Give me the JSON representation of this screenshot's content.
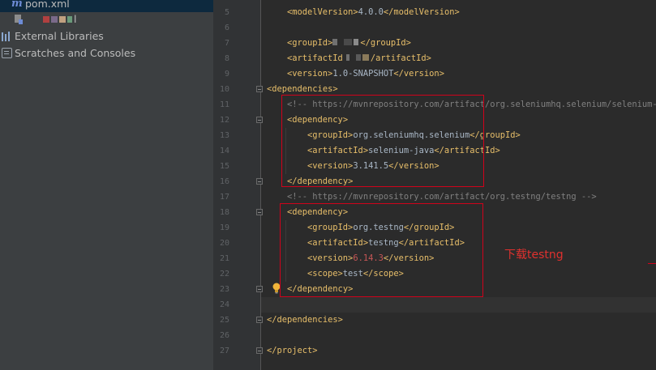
{
  "project_tree": {
    "items": [
      {
        "label": "pom.xml",
        "icon": "maven-file-icon"
      },
      {
        "label": "l",
        "icon": "module-file-icon"
      },
      {
        "label": "External Libraries",
        "icon": "library-icon"
      },
      {
        "label": "Scratches and Consoles",
        "icon": "scratches-icon"
      }
    ]
  },
  "editor": {
    "line_numbers": [
      "5",
      "6",
      "7",
      "8",
      "9",
      "10",
      "11",
      "12",
      "13",
      "14",
      "15",
      "16",
      "17",
      "18",
      "19",
      "20",
      "21",
      "22",
      "23",
      "24",
      "25",
      "26",
      "27"
    ],
    "lines": {
      "l5": {
        "open": "<modelVersion>",
        "text": "4.0.0",
        "close": "</modelVersion>"
      },
      "l7": {
        "open": "<groupId>",
        "close": "</groupId>"
      },
      "l8": {
        "open": "<artifactId",
        "close": "/artifactId>"
      },
      "l9": {
        "open": "<version>",
        "text": "1.0-SNAPSHOT",
        "close": "</version>"
      },
      "l10": {
        "open": "<dependencies>"
      },
      "l11": {
        "comment": "<!-- https://mvnrepository.com/artifact/org.seleniumhq.selenium/selenium-jav"
      },
      "l12": {
        "open": "<dependency>"
      },
      "l13": {
        "open": "<groupId>",
        "text": "org.seleniumhq.selenium",
        "close": "</groupId>"
      },
      "l14": {
        "open": "<artifactId>",
        "text": "selenium-java",
        "close": "</artifactId>"
      },
      "l15": {
        "open": "<version>",
        "text": "3.141.5",
        "close": "</version>"
      },
      "l16": {
        "close": "</dependency>"
      },
      "l17": {
        "comment": "<!-- https://mvnrepository.com/artifact/org.testng/testng -->"
      },
      "l18": {
        "open": "<dependency>"
      },
      "l19": {
        "open": "<groupId>",
        "text": "org.testng",
        "close": "</groupId>"
      },
      "l20": {
        "open": "<artifactId>",
        "text": "testng",
        "close": "</artifactId>"
      },
      "l21": {
        "open": "<version>",
        "text": "6.14.3",
        "close": "</version>"
      },
      "l22": {
        "open": "<scope>",
        "text": "test",
        "close": "</scope>"
      },
      "l23": {
        "close": "</dependency>"
      },
      "l25": {
        "close": "</dependencies>"
      },
      "l27": {
        "close": "</project>"
      }
    }
  },
  "annotation": {
    "text": "下载testng",
    "color": "#e0312e"
  },
  "colors": {
    "tag": "#e8bf6a",
    "text": "#a9b7c6",
    "comment": "#808080",
    "error": "#c65656",
    "highlight_box": "#d0021b"
  }
}
